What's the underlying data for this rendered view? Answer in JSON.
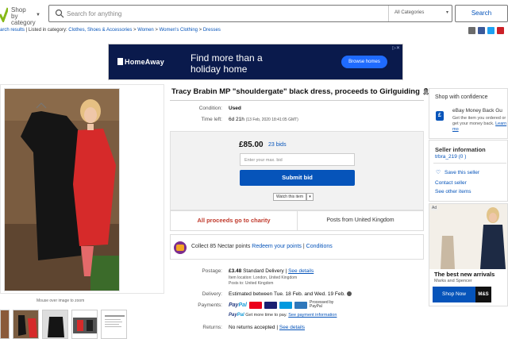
{
  "header": {
    "shop_by_category": "Shop by category",
    "search_placeholder": "Search for anything",
    "category_select": "All Categories",
    "search_button": "Search"
  },
  "breadcrumb": {
    "back": "arch results",
    "listed_in": "Listed in category:",
    "items": [
      "Clothes, Shoes & Accessories",
      "Women",
      "Women's Clothing",
      "Dresses"
    ]
  },
  "share_icons": [
    {
      "name": "email-icon",
      "color": "#6b6b6b"
    },
    {
      "name": "facebook-icon",
      "color": "#3b5998"
    },
    {
      "name": "twitter-icon",
      "color": "#1da1f2"
    },
    {
      "name": "pinterest-icon",
      "color": "#cb2027"
    }
  ],
  "ad_banner": {
    "brand": "HomeAway",
    "headline": "Find more than a holiday home",
    "cta": "Browse homes",
    "bg_color": "#0a1a4c"
  },
  "gallery": {
    "hint": "Mouse over image to zoom"
  },
  "item": {
    "title": "Tracy Brabin MP \"shouldergate\" black dress, proceeds to Girlguiding",
    "condition_label": "Condition:",
    "condition": "Used",
    "time_left_label": "Time left:",
    "time_left": "6d 21h",
    "time_left_date": "(13 Feb, 2020  18:41:05 GMT)",
    "price": "£85.00",
    "bids": "23 bids",
    "bid_placeholder": "Enter your max. bid",
    "submit_bid": "Submit bid",
    "see_item": "Watch this item",
    "charity": "All proceeds go to charity",
    "posts_from": "Posts from United Kingdom",
    "nectar_text": "Collect 85 Nectar points",
    "nectar_redeem": "Redeem your points",
    "nectar_conditions": "Conditions"
  },
  "postage": {
    "label": "Postage:",
    "price": "£3.48",
    "service": "Standard Delivery",
    "details": "See details",
    "location": "Item location:  London, United Kingdom",
    "posts_to": "Posts to:  United Kingdom"
  },
  "delivery": {
    "label": "Delivery:",
    "text": "Estimated between Tue. 18 Feb. and Wed. 19 Feb."
  },
  "payments": {
    "label": "Payments:",
    "processed": "Processed by PayPal",
    "credit_text": "Get more time to pay.",
    "credit_link": "See payment information",
    "cards": [
      {
        "name": "mastercard-icon",
        "color": "#eb001b"
      },
      {
        "name": "visa-icon",
        "color": "#1a1f71"
      },
      {
        "name": "maestro-icon",
        "color": "#0099df"
      },
      {
        "name": "amex-icon",
        "color": "#2e77bb"
      }
    ]
  },
  "returns": {
    "label": "Returns:",
    "text": "No returns accepted",
    "details": "See details"
  },
  "confidence": {
    "title": "Shop with confidence",
    "main": "eBay Money Back Gu",
    "sub": "Get the item you ordered or get your money back.",
    "learn": "Learn mo"
  },
  "seller": {
    "title": "Seller information",
    "name": "trbra_219 (0 )",
    "save": "Save this seller",
    "contact": "Contact seller",
    "other": "See other items"
  },
  "side_ad": {
    "tag": "Ad",
    "headline": "The best new arrivals",
    "sub": "Marks and Spencer",
    "cta": "Shop Now",
    "logo": "M&S"
  }
}
